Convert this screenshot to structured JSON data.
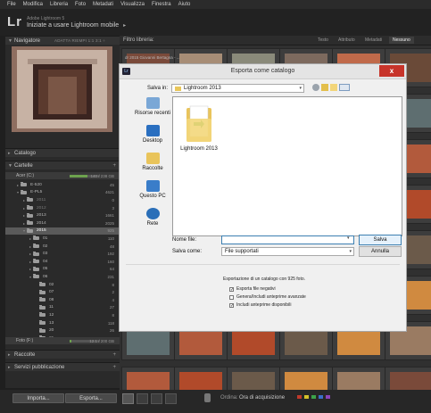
{
  "menu": [
    "File",
    "Modifica",
    "Libreria",
    "Foto",
    "Metadati",
    "Visualizza",
    "Finestra",
    "Aiuto"
  ],
  "identity": {
    "logo": "Lr",
    "line1": "Adobe Lightroom 5",
    "line2": "Iniziate a usare Lightroom mobile",
    "arrow": "▸"
  },
  "left_panel": {
    "navigator": {
      "title": "Navigatore",
      "options": "ADATTA   RIEMPI   1:1   3:1 ÷"
    },
    "catalog": "Catalogo",
    "folders": "Cartelle",
    "volumes": [
      {
        "name": "Acer (C:)",
        "count": "140 / 238 GB",
        "fill": 0.59
      },
      {
        "name": "Foto (F:)",
        "count": "12.1 / 200 GB",
        "fill": 0.06
      }
    ],
    "tree": [
      {
        "name": "E-520",
        "count": "45",
        "indent": 1,
        "twisty": "▸",
        "dim": false,
        "sel": false
      },
      {
        "name": "E-PL5",
        "count": "4621",
        "indent": 1,
        "twisty": "▾",
        "dim": false,
        "sel": false
      },
      {
        "name": "2011",
        "count": "0",
        "indent": 2,
        "twisty": "▸",
        "dim": true,
        "sel": false
      },
      {
        "name": "2012",
        "count": "3",
        "indent": 2,
        "twisty": "▸",
        "dim": true,
        "sel": false
      },
      {
        "name": "2013",
        "count": "1661",
        "indent": 2,
        "twisty": "▸",
        "dim": false,
        "sel": false
      },
      {
        "name": "2014",
        "count": "2025",
        "indent": 2,
        "twisty": "▸",
        "dim": false,
        "sel": false
      },
      {
        "name": "2015",
        "count": "925",
        "indent": 2,
        "twisty": "▾",
        "dim": false,
        "sel": true
      },
      {
        "name": "01",
        "count": "110",
        "indent": 3,
        "twisty": "▸",
        "dim": false,
        "sel": false
      },
      {
        "name": "02",
        "count": "48",
        "indent": 3,
        "twisty": "▸",
        "dim": false,
        "sel": false
      },
      {
        "name": "03",
        "count": "192",
        "indent": 3,
        "twisty": "▸",
        "dim": false,
        "sel": false
      },
      {
        "name": "04",
        "count": "160",
        "indent": 3,
        "twisty": "▸",
        "dim": false,
        "sel": false
      },
      {
        "name": "05",
        "count": "64",
        "indent": 3,
        "twisty": "▸",
        "dim": false,
        "sel": false
      },
      {
        "name": "06",
        "count": "231",
        "indent": 3,
        "twisty": "▾",
        "dim": false,
        "sel": false
      },
      {
        "name": "02",
        "count": "8",
        "indent": 4,
        "twisty": "",
        "dim": false,
        "sel": false
      },
      {
        "name": "07",
        "count": "2",
        "indent": 4,
        "twisty": "",
        "dim": false,
        "sel": false
      },
      {
        "name": "08",
        "count": "4",
        "indent": 4,
        "twisty": "",
        "dim": false,
        "sel": false
      },
      {
        "name": "11",
        "count": "27",
        "indent": 4,
        "twisty": "",
        "dim": false,
        "sel": false
      },
      {
        "name": "12",
        "count": "8",
        "indent": 4,
        "twisty": "",
        "dim": false,
        "sel": false
      },
      {
        "name": "13",
        "count": "118",
        "indent": 4,
        "twisty": "",
        "dim": false,
        "sel": false
      },
      {
        "name": "20",
        "count": "26",
        "indent": 4,
        "twisty": "",
        "dim": false,
        "sel": false
      },
      {
        "name": "21",
        "count": "56",
        "indent": 4,
        "twisty": "",
        "dim": false,
        "sel": false
      }
    ],
    "collections": "Raccolte",
    "publish": "Servizi pubblicazione"
  },
  "toolbar": {
    "import_label": "Importa...",
    "export_label": "Esporta...",
    "sort_label": "Ordina:",
    "sort_value": "Ora di acquisizione"
  },
  "grid": {
    "filter_label": "Filtro libreria:",
    "filters": [
      "Testo",
      "Attributo",
      "Metadati",
      "Nessuno"
    ],
    "caption": "dr 2015 Giovanni Bertagna - ..."
  },
  "dialog": {
    "title": "Esporta come catalogo",
    "close": "x",
    "save_in_label": "Salva in:",
    "save_in_value": "Lightroom 2013",
    "places": [
      "Risorse recenti",
      "Desktop",
      "Raccolte",
      "Questo PC",
      "Rete"
    ],
    "file_item": "Lightroom 2013",
    "filename_label": "Nome file:",
    "filename_value": "",
    "savetype_label": "Salva come:",
    "savetype_value": "File supportati",
    "save_button": "Salva",
    "cancel_button": "Annulla",
    "options_heading": "Esportazione di un catalogo con 925 foto.",
    "options": [
      {
        "label": "Esporta file negativi",
        "checked": true
      },
      {
        "label": "Genera/Includi anteprime avanzate",
        "checked": false
      },
      {
        "label": "Includi anteprime disponibili",
        "checked": true
      }
    ]
  }
}
